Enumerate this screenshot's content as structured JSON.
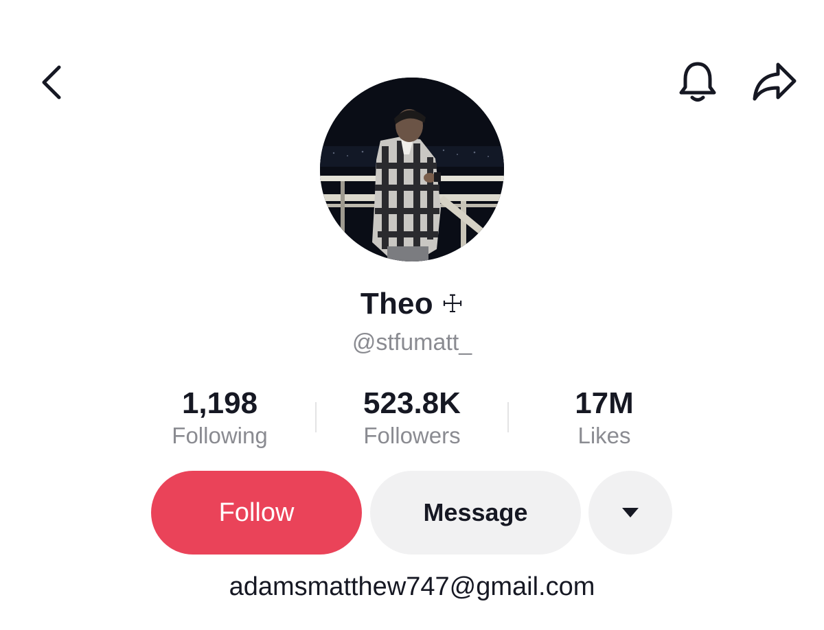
{
  "header": {
    "back_icon": "chevron-left-icon",
    "notification_icon": "bell-icon",
    "share_icon": "share-arrow-icon"
  },
  "profile": {
    "display_name": "Theo",
    "name_symbol": "☩",
    "username": "@stfumatt_"
  },
  "stats": [
    {
      "value": "1,198",
      "label": "Following"
    },
    {
      "value": "523.8K",
      "label": "Followers"
    },
    {
      "value": "17M",
      "label": "Likes"
    }
  ],
  "actions": {
    "follow_label": "Follow",
    "message_label": "Message",
    "more_icon": "caret-down-icon"
  },
  "bio": {
    "text": "adamsmatthew747@gmail.com"
  },
  "colors": {
    "follow_button": "#ea4359",
    "secondary_button": "#f1f1f2",
    "primary_text": "#161823",
    "secondary_text": "#8a8b91"
  }
}
